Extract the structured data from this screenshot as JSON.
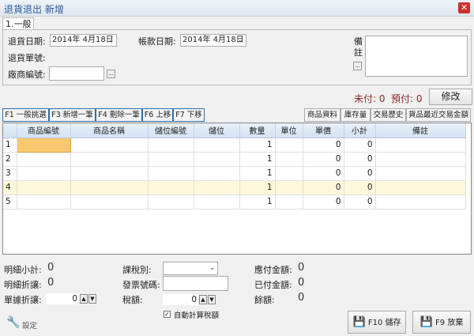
{
  "window": {
    "title": "退貨退出 新增",
    "close": "✕"
  },
  "tab": "1.一般",
  "form": {
    "return_date_label": "退貨日期:",
    "return_date": "2014年  4月18日",
    "account_date_label": "帳款日期:",
    "account_date": "2014年  4月18日",
    "return_no_label": "退貨單號:",
    "vendor_no_label": "廠商編號:",
    "vendor_no": "",
    "browse": "...",
    "remark_label_1": "備",
    "remark_label_2": "註",
    "remark": ""
  },
  "status": {
    "unpaid": "未付: 0",
    "prepaid": "預付: 0",
    "edit": "修改"
  },
  "toolbar": [
    "F1 一般挑選",
    "F3 新增一筆",
    "F4 刪除一筆",
    "F6 上移",
    "F7 下移"
  ],
  "right_toolbar": [
    "商品資料",
    "庫存量",
    "交易歷史",
    "貨品最近交易金額"
  ],
  "grid": {
    "columns": [
      "",
      "商品編號",
      "商品名稱",
      "儲位編號",
      "儲位",
      "數量",
      "單位",
      "單價",
      "小計",
      "備註"
    ],
    "rows": [
      [
        "1",
        "",
        "",
        "",
        "",
        "1",
        "",
        "0",
        "0",
        ""
      ],
      [
        "2",
        "",
        "",
        "",
        "",
        "1",
        "",
        "0",
        "0",
        ""
      ],
      [
        "3",
        "",
        "",
        "",
        "",
        "1",
        "",
        "0",
        "0",
        ""
      ],
      [
        "4",
        "",
        "",
        "",
        "",
        "1",
        "",
        "0",
        "0",
        ""
      ],
      [
        "5",
        "",
        "",
        "",
        "",
        "1",
        "",
        "0",
        "0",
        ""
      ]
    ]
  },
  "summary": {
    "detail_subtotal_label": "明細小計:",
    "detail_subtotal": "0",
    "detail_discount_label": "明細折讓:",
    "detail_discount": "0",
    "doc_discount_label": "單據折讓:",
    "doc_discount": "0",
    "tax_type_label": "課稅別:",
    "tax_type": "",
    "invoice_label": "發票號碼:",
    "invoice": "",
    "tax_label": "稅額:",
    "tax": "0",
    "auto_tax_label": "自動計算稅額",
    "payable_label": "應付金額:",
    "payable": "0",
    "paid_label": "已付金額:",
    "paid": "0",
    "balance_label": "餘額:",
    "balance": "0"
  },
  "footer": {
    "settings": "設定",
    "save": "F10 儲存",
    "discard": "F9 放棄"
  },
  "colors": {
    "accent": "#2f6faa",
    "status_red": "#8b2a2a",
    "selected_cell": "#f8c870",
    "highlight_row": "#fdf8dc"
  }
}
